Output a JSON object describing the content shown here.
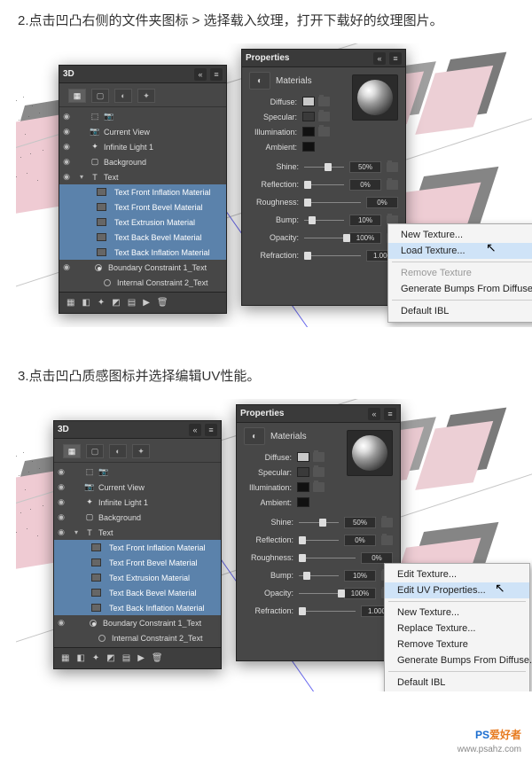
{
  "step2": {
    "heading": "2.点击凹凸右侧的文件夹图标 > 选择载入纹理，打开下载好的纹理图片。"
  },
  "step3": {
    "heading": "3.点击凹凸质感图标并选择编辑UV性能。"
  },
  "panel3D": {
    "title": "3D",
    "layers": {
      "currentView": "Current View",
      "infiniteLight": "Infinite Light 1",
      "background": "Background",
      "text": "Text",
      "mat1": "Text Front Inflation Material",
      "mat2": "Text Front Bevel Material",
      "mat3": "Text Extrusion Material",
      "mat4": "Text Back Bevel Material",
      "mat5": "Text Back Inflation Material",
      "bc1": "Boundary Constraint 1_Text",
      "bc2": "Internal Constraint 2_Text"
    }
  },
  "propsPanel": {
    "title": "Properties",
    "subtitle": "Materials",
    "labels": {
      "diffuse": "Diffuse:",
      "specular": "Specular:",
      "illumination": "Illumination:",
      "ambient": "Ambient:",
      "shine": "Shine:",
      "reflection": "Reflection:",
      "roughness": "Roughness:",
      "bump": "Bump:",
      "opacity": "Opacity:",
      "refraction": "Refraction:"
    },
    "values": {
      "shine": "50%",
      "reflection": "0%",
      "roughness": "0%",
      "bump": "10%",
      "opacity": "100%",
      "refraction": "1.000"
    }
  },
  "menu1": {
    "newTexture": "New Texture...",
    "loadTexture": "Load Texture...",
    "removeTexture": "Remove Texture",
    "genBumps": "Generate Bumps From Diffuse...",
    "defaultIBL": "Default IBL"
  },
  "menu2": {
    "editTexture": "Edit Texture...",
    "editUV": "Edit UV Properties...",
    "newTexture": "New Texture...",
    "replaceTexture": "Replace Texture...",
    "removeTexture": "Remove Texture",
    "genBumps": "Generate Bumps From Diffuse...",
    "defaultIBL": "Default IBL"
  },
  "colors": {
    "diffuse": "#c9c9c9",
    "specular": "#3a3a3a",
    "illumination": "#111111",
    "ambient": "#111111"
  },
  "watermark": {
    "ps": "PS",
    "hao": "爱好者",
    "url": "www.psahz.com"
  }
}
